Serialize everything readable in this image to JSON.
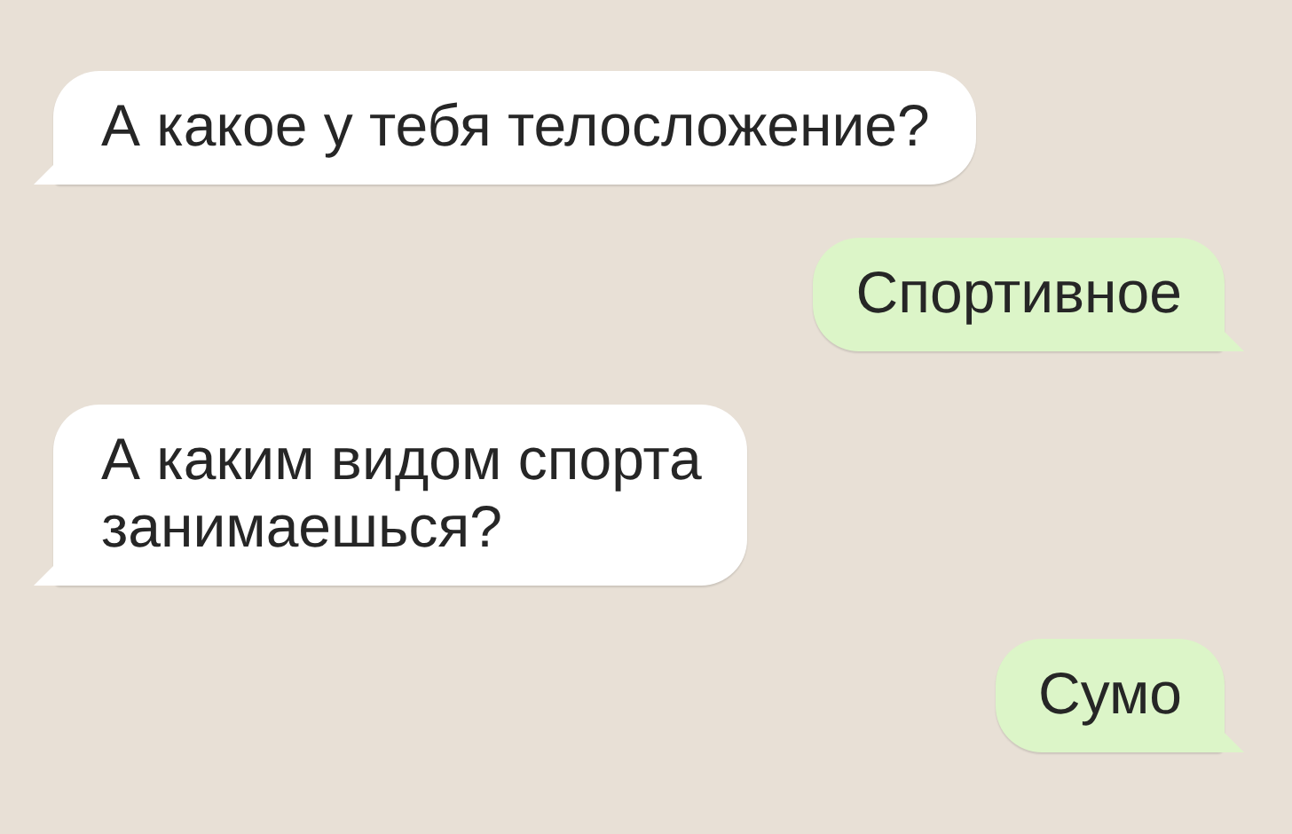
{
  "messages": [
    {
      "kind": "incoming",
      "text": "А какое у тебя телосложение?"
    },
    {
      "kind": "outgoing",
      "text": "Спортивное"
    },
    {
      "kind": "incoming",
      "text": "А каким видом спорта\nзанимаешься?"
    },
    {
      "kind": "outgoing",
      "text": "Сумо"
    }
  ]
}
